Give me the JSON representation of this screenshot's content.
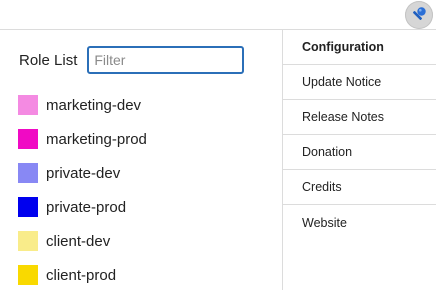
{
  "toolbar": {
    "tool_icon": "magic-wand-icon",
    "tool_icon_color": "#2b6fd6"
  },
  "role_panel": {
    "title": "Role List",
    "filter_placeholder": "Filter",
    "filter_value": "",
    "roles": [
      {
        "label": "marketing-dev",
        "color": "#f48ae2"
      },
      {
        "label": "marketing-prod",
        "color": "#f00ac4"
      },
      {
        "label": "private-dev",
        "color": "#8888f4"
      },
      {
        "label": "private-prod",
        "color": "#0000ee"
      },
      {
        "label": "client-dev",
        "color": "#f9ec8a"
      },
      {
        "label": "client-prod",
        "color": "#f9d900"
      }
    ]
  },
  "menu": {
    "items": [
      {
        "label": "Configuration",
        "active": true
      },
      {
        "label": "Update Notice",
        "active": false
      },
      {
        "label": "Release Notes",
        "active": false
      },
      {
        "label": "Donation",
        "active": false
      },
      {
        "label": "Credits",
        "active": false
      },
      {
        "label": "Website",
        "active": false
      }
    ]
  }
}
